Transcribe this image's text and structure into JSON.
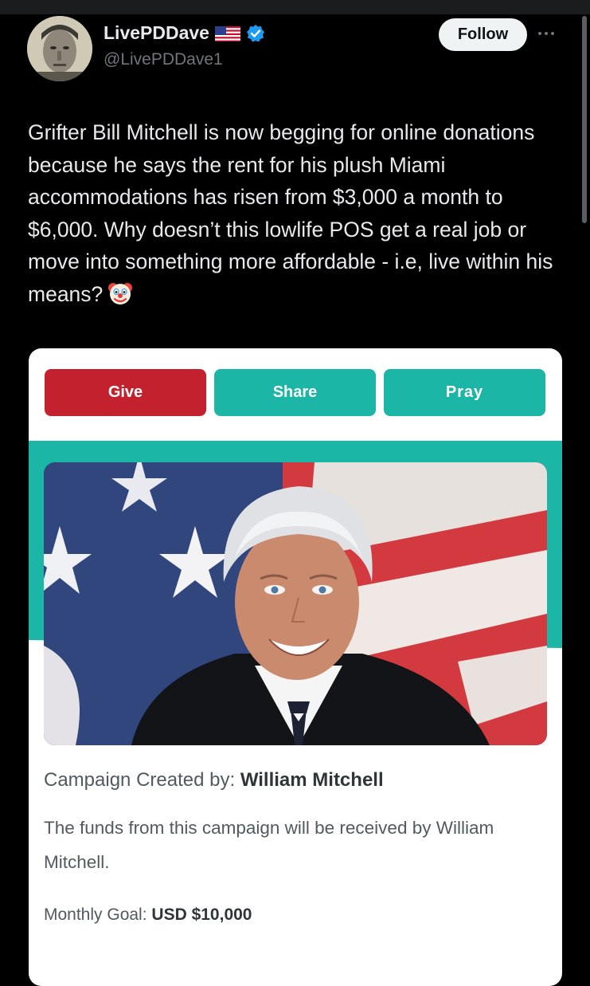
{
  "post": {
    "display_name": "LivePDDave",
    "handle": "@LivePDDave1",
    "follow_label": "Follow",
    "text": "Grifter Bill Mitchell is now begging for online donations because he says the rent for his plush Miami accommodations has risen from $3,000 a month to $6,000. Why doesn’t this lowlife POS get a real job or move into something more affordable - i.e, live within his means?",
    "emoji": "clown-face-icon"
  },
  "campaign": {
    "buttons": {
      "give": "Give",
      "share": "Share",
      "pray": "Pray"
    },
    "created_by_label": "Campaign Created by:",
    "created_by_name": "William Mitchell",
    "funds_note": "The funds from this campaign will be received by William Mitchell.",
    "goal_label": "Monthly Goal:",
    "goal_value": "USD $10,000"
  },
  "colors": {
    "give": "#c4212f",
    "teal": "#1bb6a5",
    "verified": "#1d9bf0"
  }
}
